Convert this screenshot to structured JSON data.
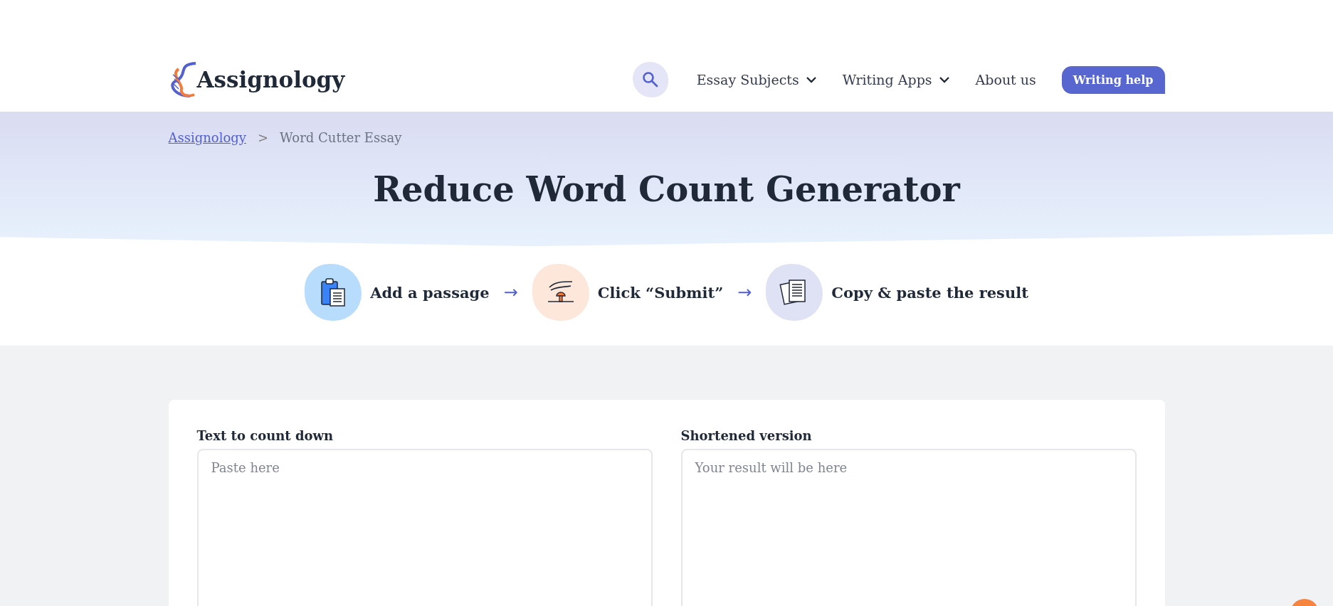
{
  "header": {
    "logo": "Assignology",
    "nav": [
      {
        "label": "Essay Subjects",
        "dropdown": true
      },
      {
        "label": "Writing Apps",
        "dropdown": true
      },
      {
        "label": "About us",
        "dropdown": false
      }
    ],
    "cta": "Writing help"
  },
  "breadcrumb": {
    "link": "Assignology",
    "separator": ">",
    "current": "Word Cutter Essay"
  },
  "title": "Reduce Word Count Generator",
  "steps": [
    {
      "label": "Add a passage",
      "arrow": "→"
    },
    {
      "label": "Click “Submit”",
      "arrow": "→"
    },
    {
      "label": "Copy & paste the result"
    }
  ],
  "form": {
    "fields": [
      {
        "label": "Text to count down",
        "placeholder": "Paste here"
      },
      {
        "label": "Shortened version",
        "placeholder": "Your result will be here"
      }
    ]
  }
}
